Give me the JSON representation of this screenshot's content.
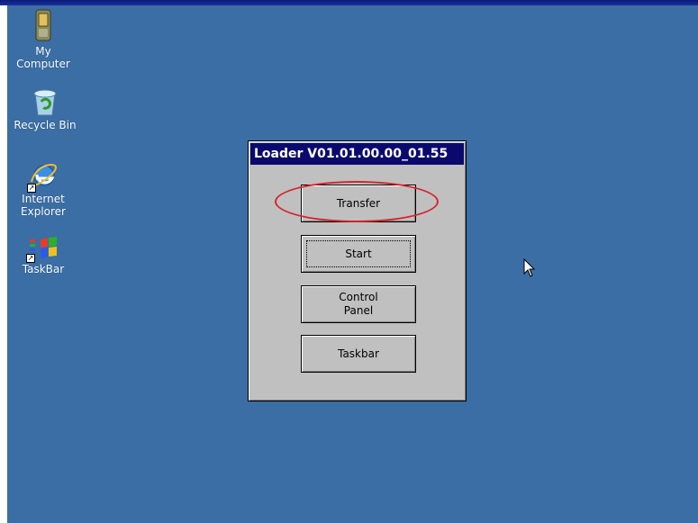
{
  "desktop": {
    "background_color": "#3a6ea5",
    "icons": [
      {
        "label": "My\nComputer",
        "icon": "my-computer-icon"
      },
      {
        "label": "Recycle Bin",
        "icon": "recycle-bin-icon"
      },
      {
        "label": "Internet\nExplorer",
        "icon": "internet-explorer-icon"
      },
      {
        "label": "TaskBar",
        "icon": "taskbar-icon"
      }
    ]
  },
  "dialog": {
    "title": "Loader V01.01.00.00_01.55",
    "title_bar_color": "#0a0a6e",
    "buttons": [
      {
        "label": "Transfer",
        "highlighted": true
      },
      {
        "label": "Start",
        "focused": true
      },
      {
        "label": "Control\nPanel"
      },
      {
        "label": "Taskbar"
      }
    ]
  },
  "annotation": {
    "color": "#d8222a",
    "shape": "ellipse",
    "target": "Transfer"
  }
}
